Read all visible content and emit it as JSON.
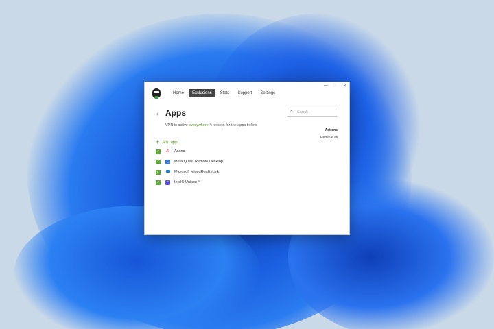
{
  "nav": {
    "items": [
      "Home",
      "Exclusions",
      "Stats",
      "Support",
      "Settings"
    ],
    "active": 1
  },
  "window_controls": {
    "minimize": "—",
    "maximize": "□",
    "close": "✕"
  },
  "page": {
    "title": "Apps",
    "back": "‹",
    "search_placeholder": "Search",
    "status_prefix": "VPN is active",
    "status_link": "everywhere",
    "status_suffix": "except for the apps below",
    "actions_label": "Actions",
    "remove_all": "Remove all",
    "add_app": "Add app"
  },
  "apps": [
    {
      "name": "Asana",
      "icon": "asana-icon",
      "color": "#e8485a"
    },
    {
      "name": "Meta Quest Remote Desktop",
      "icon": "meta-quest-icon",
      "color": "#3b7ad8"
    },
    {
      "name": "Microsoft MixedRealityLink",
      "icon": "mixed-reality-icon",
      "color": "#1e7bc8"
    },
    {
      "name": "Intel® Unison™",
      "icon": "intel-unison-icon",
      "color": "#5b4fd8"
    }
  ]
}
